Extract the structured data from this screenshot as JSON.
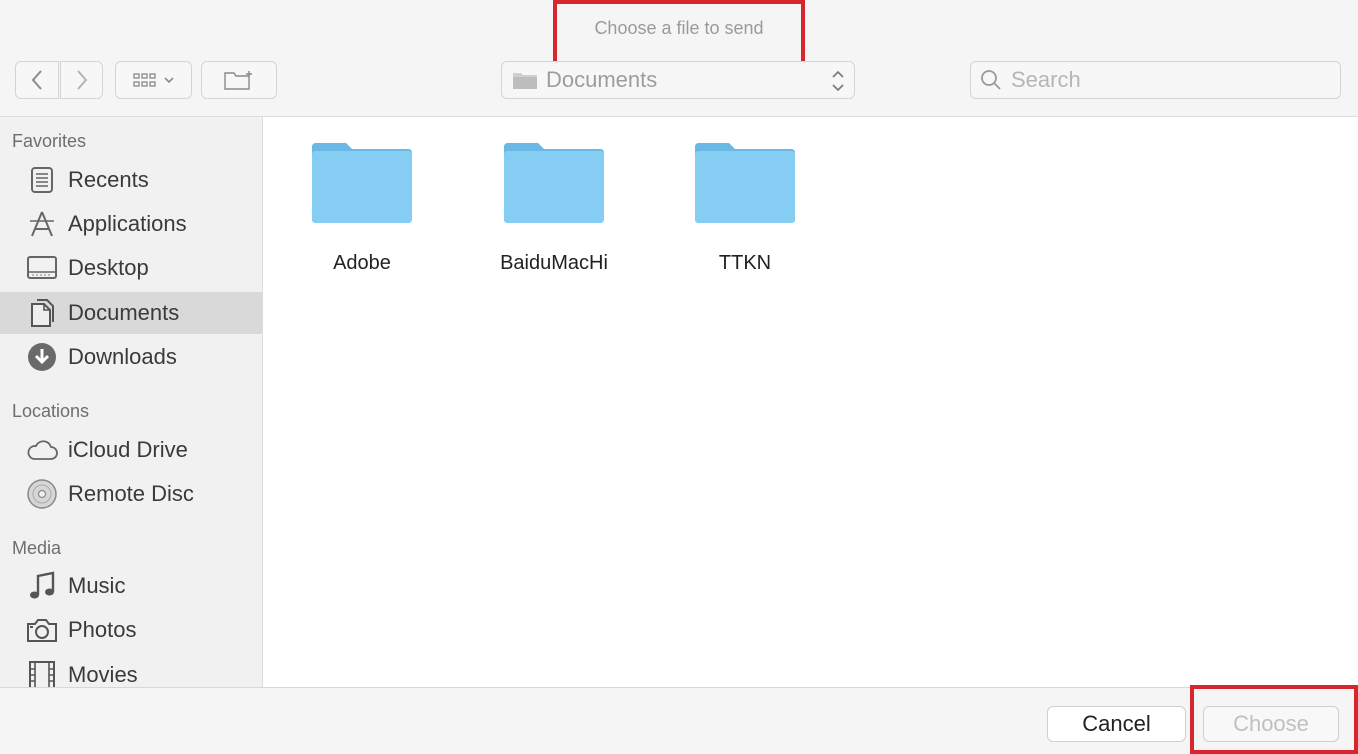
{
  "dialog": {
    "title": "Choose a file to send"
  },
  "toolbar": {
    "path_label": "Documents",
    "search_placeholder": "Search"
  },
  "sidebar": {
    "sections": [
      {
        "title": "Favorites"
      },
      {
        "title": "Locations"
      },
      {
        "title": "Media"
      }
    ],
    "items": [
      {
        "label": "Recents",
        "icon": "recents-icon"
      },
      {
        "label": "Applications",
        "icon": "applications-icon"
      },
      {
        "label": "Desktop",
        "icon": "desktop-icon"
      },
      {
        "label": "Documents",
        "icon": "documents-icon",
        "selected": true
      },
      {
        "label": "Downloads",
        "icon": "downloads-icon"
      },
      {
        "label": "iCloud Drive",
        "icon": "cloud-icon"
      },
      {
        "label": "Remote Disc",
        "icon": "disc-icon"
      },
      {
        "label": "Music",
        "icon": "music-icon"
      },
      {
        "label": "Photos",
        "icon": "camera-icon"
      },
      {
        "label": "Movies",
        "icon": "film-icon"
      }
    ]
  },
  "files": [
    {
      "name": "Adobe",
      "type": "folder"
    },
    {
      "name": "BaiduMacHi",
      "type": "folder"
    },
    {
      "name": "TTKN",
      "type": "folder"
    }
  ],
  "footer": {
    "cancel_label": "Cancel",
    "choose_label": "Choose"
  },
  "colors": {
    "highlight": "#d8262e",
    "folder": "#7cc4ee",
    "selected_row": "#d9d9d9"
  }
}
